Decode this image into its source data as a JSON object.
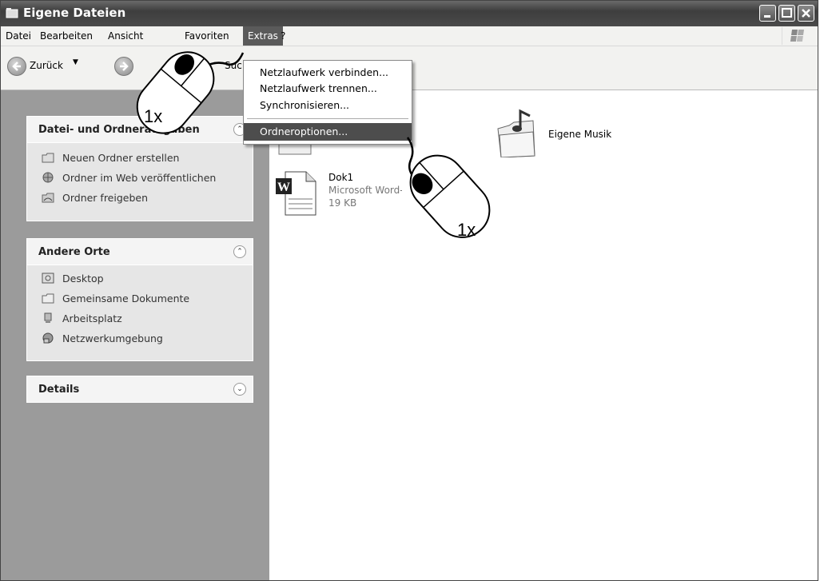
{
  "window": {
    "title": "Eigene Dateien"
  },
  "menubar": {
    "items": [
      "Datei",
      "Bearbeiten",
      "Ansicht",
      "Favoriten",
      "Extras",
      "?"
    ]
  },
  "toolbar": {
    "back_label": "Zurück",
    "search_partial": "Suc"
  },
  "extras_menu": {
    "items": [
      "Netzlaufwerk verbinden...",
      "Netzlaufwerk trennen...",
      "Synchronisieren...",
      "Ordneroptionen..."
    ],
    "selected": "Ordneroptionen..."
  },
  "panels": {
    "tasks": {
      "title": "Datei- und Ordneraufgaben",
      "items": [
        "Neuen Ordner erstellen",
        "Ordner im Web veröffentlichen",
        "Ordner freigeben"
      ]
    },
    "places": {
      "title": "Andere Orte",
      "items": [
        "Desktop",
        "Gemeinsame Dokumente",
        "Arbeitsplatz",
        "Netzwerkumgebung"
      ]
    },
    "details": {
      "title": "Details"
    }
  },
  "files": [
    {
      "name": "Eigene Musik",
      "icon": "music-folder-icon"
    },
    {
      "name": "Dok1",
      "type": "Microsoft Word-Dokument",
      "size": "19 KB",
      "icon": "word-document-icon"
    }
  ],
  "annotations": {
    "mouse1": "1x",
    "mouse2": "1x"
  },
  "colors": {
    "titlebar": "#4a4a4a",
    "menu_active": "#5a5a5a",
    "sidepane": "#9b9b9b",
    "panel": "#e6e6e6"
  }
}
